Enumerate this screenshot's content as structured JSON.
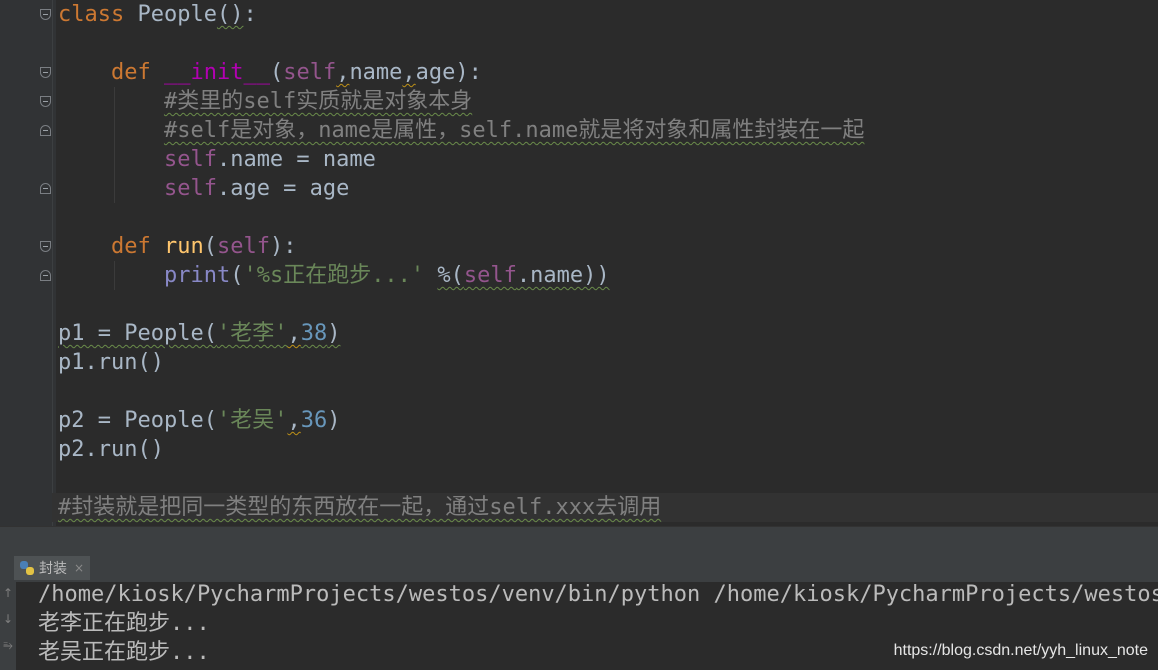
{
  "editor": {
    "lines": [
      {
        "tokens": [
          {
            "t": "class",
            "c": "kw"
          },
          {
            "t": " People",
            "c": "plain"
          },
          {
            "t": "()",
            "c": "plain sq"
          },
          {
            "t": ":",
            "c": "plain"
          }
        ]
      },
      {
        "tokens": []
      },
      {
        "tokens": [
          {
            "t": "    ",
            "c": "plain"
          },
          {
            "t": "def",
            "c": "kw"
          },
          {
            "t": " ",
            "c": "plain"
          },
          {
            "t": "__init__",
            "c": "magic"
          },
          {
            "t": "(",
            "c": "plain"
          },
          {
            "t": "self",
            "c": "self"
          },
          {
            "t": ",",
            "c": "plain sqo"
          },
          {
            "t": "name",
            "c": "plain"
          },
          {
            "t": ",",
            "c": "plain sqo"
          },
          {
            "t": "age",
            "c": "plain"
          },
          {
            "t": "):",
            "c": "plain"
          }
        ]
      },
      {
        "tokens": [
          {
            "t": "        ",
            "c": "plain"
          },
          {
            "t": "#类里的self实质就是对象本身",
            "c": "cm sq"
          }
        ]
      },
      {
        "tokens": [
          {
            "t": "        ",
            "c": "plain"
          },
          {
            "t": "#self是对象，name是属性，self.name就是将对象和属性封装在一起",
            "c": "cm sq"
          }
        ]
      },
      {
        "tokens": [
          {
            "t": "        ",
            "c": "plain"
          },
          {
            "t": "self",
            "c": "self"
          },
          {
            "t": ".name = name",
            "c": "plain"
          }
        ]
      },
      {
        "tokens": [
          {
            "t": "        ",
            "c": "plain"
          },
          {
            "t": "self",
            "c": "self"
          },
          {
            "t": ".age = age",
            "c": "plain"
          }
        ]
      },
      {
        "tokens": []
      },
      {
        "tokens": [
          {
            "t": "    ",
            "c": "plain"
          },
          {
            "t": "def",
            "c": "kw"
          },
          {
            "t": " ",
            "c": "plain"
          },
          {
            "t": "run",
            "c": "fn"
          },
          {
            "t": "(",
            "c": "plain"
          },
          {
            "t": "self",
            "c": "self"
          },
          {
            "t": "):",
            "c": "plain"
          }
        ]
      },
      {
        "tokens": [
          {
            "t": "        ",
            "c": "plain"
          },
          {
            "t": "print",
            "c": "builtin"
          },
          {
            "t": "(",
            "c": "plain"
          },
          {
            "t": "'%s正在跑步...'",
            "c": "str"
          },
          {
            "t": " ",
            "c": "plain"
          },
          {
            "t": "%(",
            "c": "plain sq"
          },
          {
            "t": "self",
            "c": "self sq"
          },
          {
            "t": ".name))",
            "c": "plain sq"
          }
        ]
      },
      {
        "tokens": []
      },
      {
        "tokens": [
          {
            "t": "p1 = People(",
            "c": "plain sq"
          },
          {
            "t": "'老李'",
            "c": "str sq"
          },
          {
            "t": ",",
            "c": "plain sqo"
          },
          {
            "t": "38",
            "c": "num sq"
          },
          {
            "t": ")",
            "c": "plain sq"
          }
        ]
      },
      {
        "tokens": [
          {
            "t": "p1.run()",
            "c": "plain"
          }
        ]
      },
      {
        "tokens": []
      },
      {
        "tokens": [
          {
            "t": "p2 = People(",
            "c": "plain"
          },
          {
            "t": "'老吴'",
            "c": "str"
          },
          {
            "t": ",",
            "c": "plain sqo"
          },
          {
            "t": "36",
            "c": "num"
          },
          {
            "t": ")",
            "c": "plain"
          }
        ]
      },
      {
        "tokens": [
          {
            "t": "p2.run()",
            "c": "plain"
          }
        ]
      },
      {
        "tokens": []
      },
      {
        "tokens": [
          {
            "t": "#封装就是把同一类型的东西放在一起，通过self.xxx去调用",
            "c": "cm sq"
          }
        ],
        "current": true
      }
    ]
  },
  "run_panel": {
    "tab_label": "封装",
    "tab_close": "×",
    "output": [
      "/home/kiosk/PycharmProjects/westos/venv/bin/python /home/kiosk/PycharmProjects/westos/",
      "老李正在跑步...",
      "老吴正在跑步..."
    ]
  },
  "watermark": "https://blog.csdn.net/yyh_linux_note"
}
